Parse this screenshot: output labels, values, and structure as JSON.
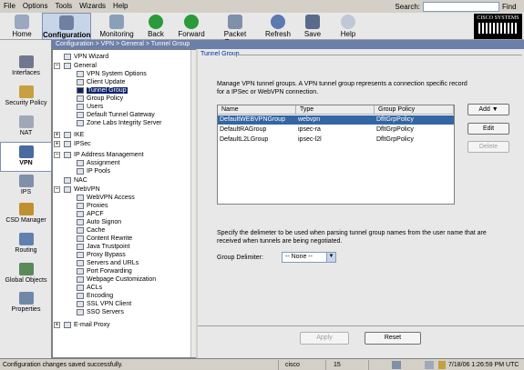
{
  "menubar": {
    "items": [
      "File",
      "Options",
      "Tools",
      "Wizards",
      "Help"
    ],
    "search_label": "Search:",
    "search_value": "",
    "find_label": "Find"
  },
  "toolbar": {
    "buttons": [
      {
        "label": "Home",
        "icon": "home-icon"
      },
      {
        "label": "Configuration",
        "icon": "configuration-icon"
      },
      {
        "label": "Monitoring",
        "icon": "monitoring-icon"
      },
      {
        "label": "Back",
        "icon": "back-arrow-icon"
      },
      {
        "label": "Forward",
        "icon": "forward-arrow-icon"
      },
      {
        "label": "Packet Tracer",
        "icon": "packet-tracer-icon"
      },
      {
        "label": "Refresh",
        "icon": "refresh-icon"
      },
      {
        "label": "Save",
        "icon": "save-icon"
      },
      {
        "label": "Help",
        "icon": "help-icon"
      }
    ],
    "brand": "CISCO SYSTEMS"
  },
  "leftnav": {
    "items": [
      {
        "label": "Interfaces",
        "icon": "interfaces-icon"
      },
      {
        "label": "Security Policy",
        "icon": "security-policy-icon"
      },
      {
        "label": "NAT",
        "icon": "nat-icon"
      },
      {
        "label": "VPN",
        "icon": "vpn-icon"
      },
      {
        "label": "IPS",
        "icon": "ips-icon"
      },
      {
        "label": "CSD Manager",
        "icon": "csd-manager-icon"
      },
      {
        "label": "Routing",
        "icon": "routing-icon"
      },
      {
        "label": "Global Objects",
        "icon": "global-objects-icon"
      },
      {
        "label": "Properties",
        "icon": "properties-icon"
      }
    ]
  },
  "breadcrumb": "Configuration > VPN > General > Tunnel Group",
  "tree": {
    "nodes": [
      {
        "label": "VPN Wizard",
        "level": 0
      },
      {
        "label": "General",
        "level": 0
      },
      {
        "label": "VPN System Options",
        "level": 1
      },
      {
        "label": "Client Update",
        "level": 1
      },
      {
        "label": "Tunnel Group",
        "level": 1
      },
      {
        "label": "Group Policy",
        "level": 1
      },
      {
        "label": "Users",
        "level": 1
      },
      {
        "label": "Default Tunnel Gateway",
        "level": 1
      },
      {
        "label": "Zone Labs Integrity Server",
        "level": 1
      },
      {
        "label": "IKE",
        "level": 0
      },
      {
        "label": "IPSec",
        "level": 0
      },
      {
        "label": "IP Address Management",
        "level": 0
      },
      {
        "label": "Assignment",
        "level": 1
      },
      {
        "label": "IP Pools",
        "level": 1
      },
      {
        "label": "NAC",
        "level": 0
      },
      {
        "label": "WebVPN",
        "level": 0
      },
      {
        "label": "WebVPN Access",
        "level": 1
      },
      {
        "label": "Proxies",
        "level": 1
      },
      {
        "label": "APCF",
        "level": 1
      },
      {
        "label": "Auto Signon",
        "level": 1
      },
      {
        "label": "Cache",
        "level": 1
      },
      {
        "label": "Content Rewrite",
        "level": 1
      },
      {
        "label": "Java Trustpoint",
        "level": 1
      },
      {
        "label": "Proxy Bypass",
        "level": 1
      },
      {
        "label": "Servers and URLs",
        "level": 1
      },
      {
        "label": "Port Forwarding",
        "level": 1
      },
      {
        "label": "Webpage Customization",
        "level": 1
      },
      {
        "label": "ACLs",
        "level": 1
      },
      {
        "label": "Encoding",
        "level": 1
      },
      {
        "label": "SSL VPN Client",
        "level": 1
      },
      {
        "label": "SSO Servers",
        "level": 1
      },
      {
        "label": "E-mail Proxy",
        "level": 0
      }
    ]
  },
  "panel": {
    "title": "Tunnel Group",
    "description": "Manage VPN tunnel groups. A VPN tunnel group represents a connection specific record for a IPSec or WebVPN connection.",
    "columns": [
      "Name",
      "Type",
      "Group Policy"
    ],
    "rows": [
      [
        "DefaultWEBVPNGroup",
        "webvpn",
        "DfltGrpPolicy"
      ],
      [
        "DefaultRAGroup",
        "ipsec-ra",
        "DfltGrpPolicy"
      ],
      [
        "DefaultL2LGroup",
        "ipsec-l2l",
        "DfltGrpPolicy"
      ]
    ],
    "add_label": "Add",
    "edit_label": "Edit",
    "delete_label": "Delete",
    "delimiter_text": "Specify the delimeter to be used when parsing tunnel group names from the user name that are received when tunnels are being negotiated.",
    "delimiter_label": "Group Delimiter:",
    "delimiter_value": "-- None --",
    "apply_label": "Apply",
    "reset_label": "Reset"
  },
  "status": {
    "message": "Configuration changes saved successfully.",
    "user": "cisco",
    "privilege": "15",
    "datetime": "7/18/06 1:26:59 PM UTC"
  }
}
